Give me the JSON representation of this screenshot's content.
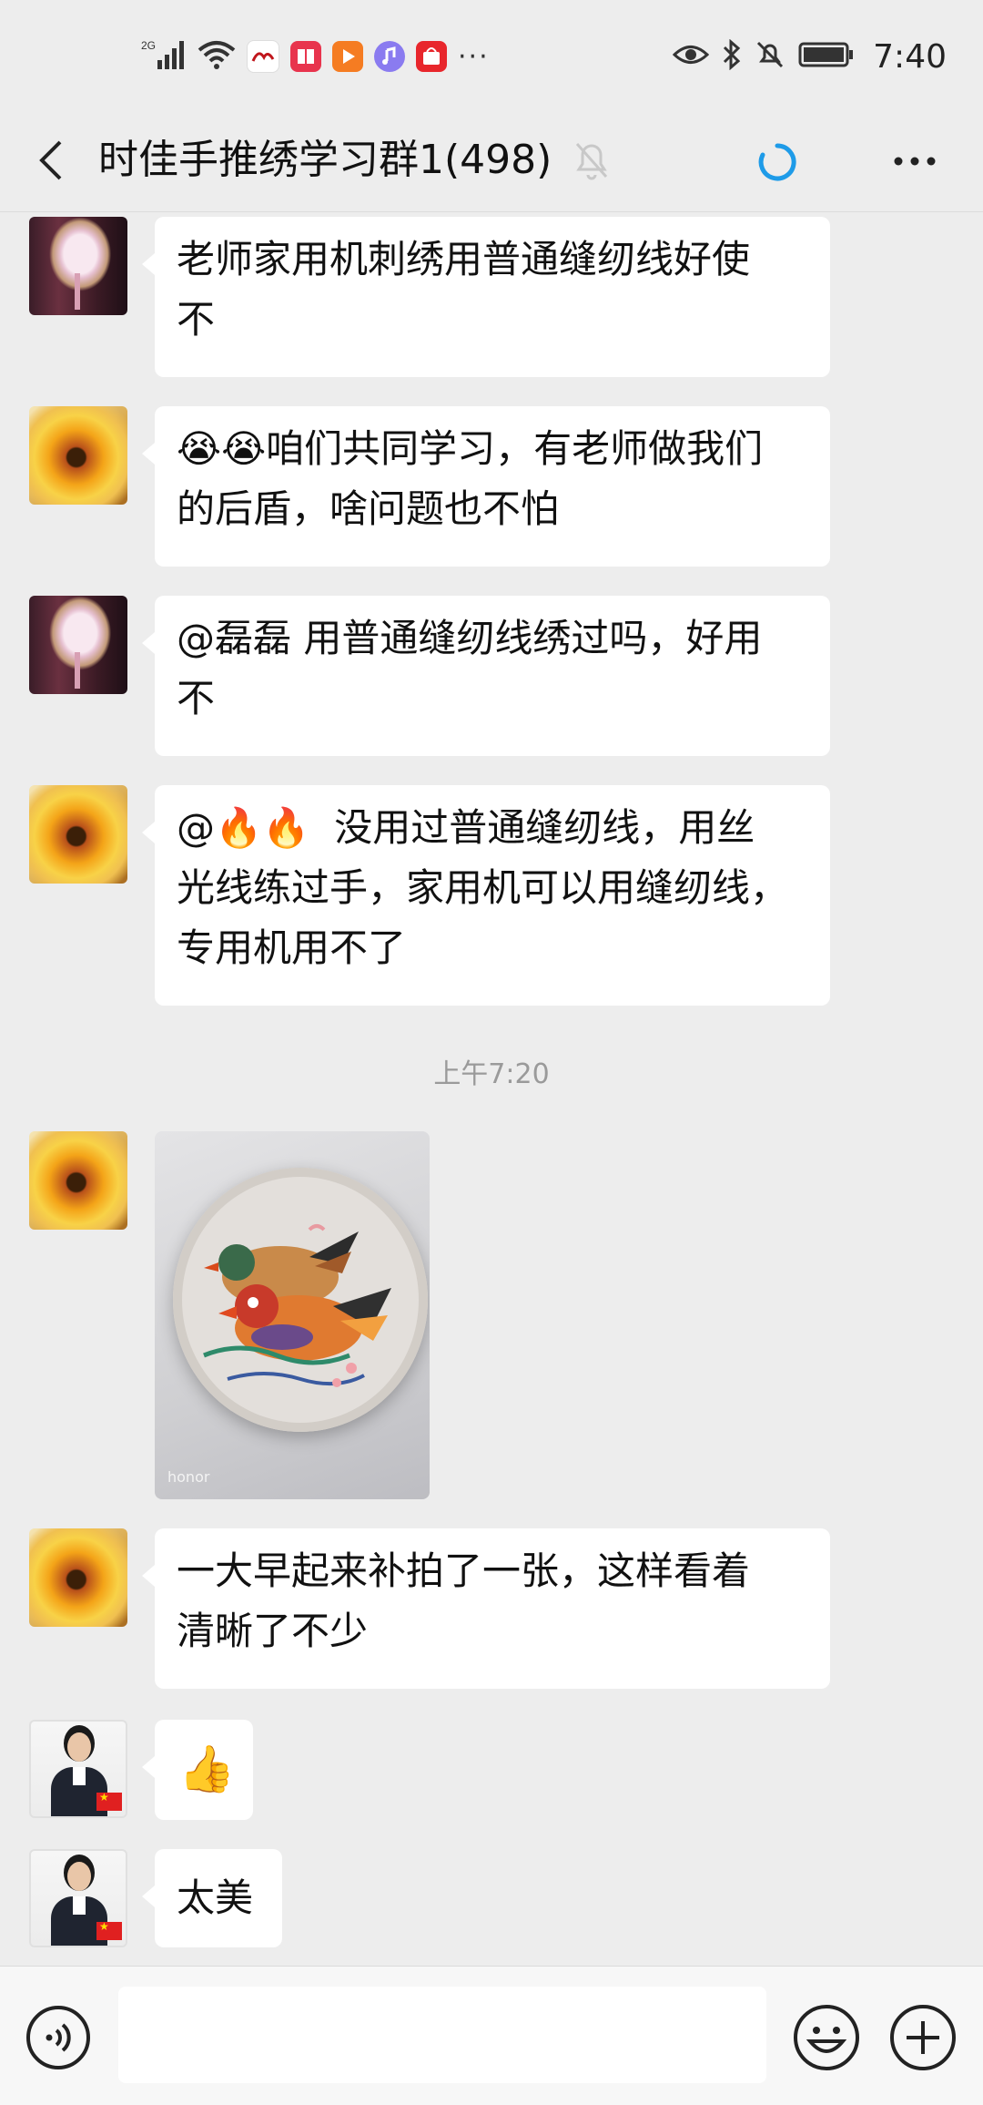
{
  "status_bar": {
    "network": "2G",
    "time": "7:40",
    "more": "···"
  },
  "header": {
    "title": "时佳手推绣学习群1(498)"
  },
  "messages": [
    {
      "sender": "fan-avatar",
      "text_line1": "老师家用机刺绣用普通缝纫线好使",
      "text_line2": "不"
    },
    {
      "sender": "flower-avatar",
      "emoji": "😭😭",
      "text_line1": "咱们共同学习，有老师做我们",
      "text_line2": "的后盾，啥问题也不怕"
    },
    {
      "sender": "fan-avatar",
      "text_line1": "@磊磊  用普通缝纫线绣过吗，好用",
      "text_line2": "不"
    },
    {
      "sender": "flower-avatar",
      "mention": "@🔥🔥",
      "text_line1": "没用过普通缝纫线，用丝",
      "text_line2": "光线练过手，家用机可以用缝纫线，",
      "text_line3": "专用机用不了"
    },
    {
      "sender": "flower-avatar",
      "type": "image",
      "caption": "honor"
    },
    {
      "sender": "flower-avatar",
      "text_line1": "一大早起来补拍了一张，这样看着",
      "text_line2": "清晰了不少"
    },
    {
      "sender": "person-avatar",
      "emoji": "👍"
    },
    {
      "sender": "person-avatar",
      "text_line1": "太美"
    }
  ],
  "timestamp": "上午7:20",
  "colors": {
    "background": "#ededed",
    "bubble": "#ffffff",
    "accent_loading": "#1e9be8"
  }
}
